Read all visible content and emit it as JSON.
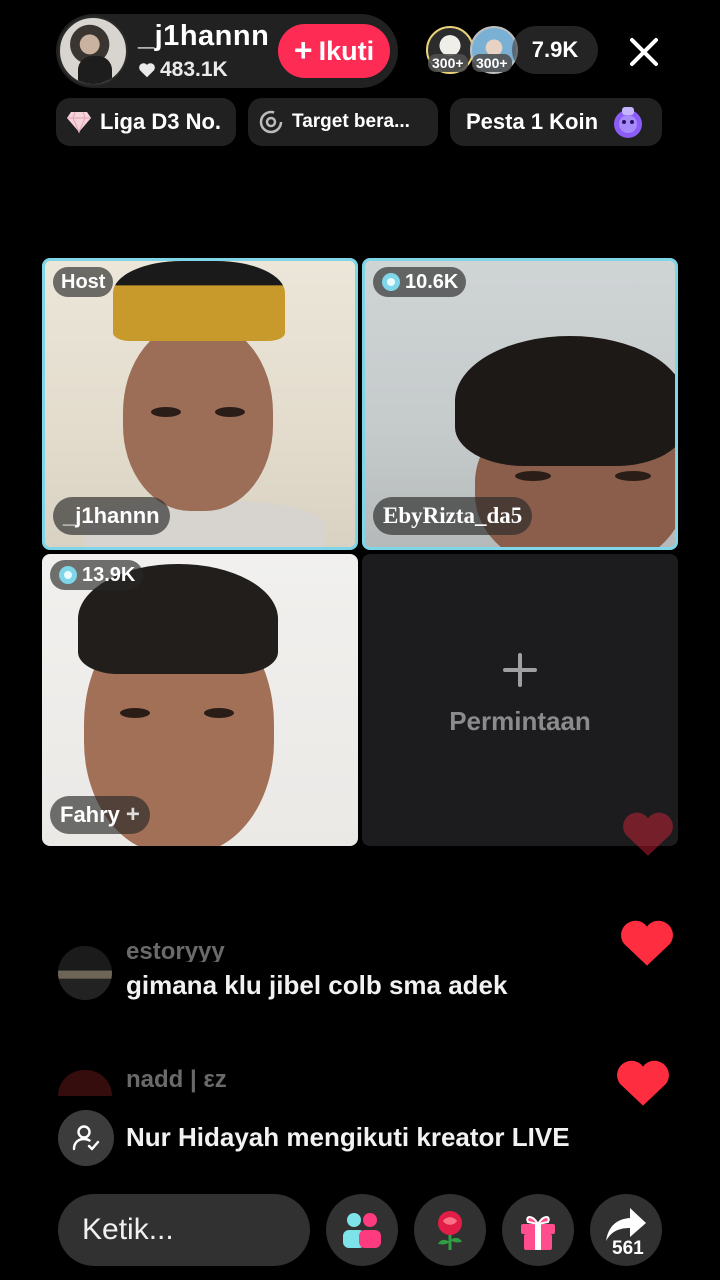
{
  "header": {
    "host_name": "_j1hannn",
    "host_likes": "483.1K",
    "follow_label": "Ikuti",
    "viewer_badges": [
      "300+",
      "300+"
    ],
    "viewer_count": "7.9K"
  },
  "chips": [
    {
      "label": "Liga D3 No.",
      "icon": "diamond-icon"
    },
    {
      "label": "Target bera...",
      "icon": "target-icon"
    },
    {
      "label": "Pesta 1 Koin",
      "icon": "treasure-bag-icon"
    }
  ],
  "grid": {
    "tiles": [
      {
        "badge": "Host",
        "name": "_j1hannn"
      },
      {
        "badge": "10.6K",
        "name": "EbyRizta_da5"
      },
      {
        "badge": "13.9K",
        "name": "Fahry"
      }
    ],
    "request_label": "Permintaan"
  },
  "comments": [
    {
      "user": "estoryyy",
      "text": "gimana klu jibel colb sma adek"
    },
    {
      "user": "nadd | εz",
      "text": ""
    }
  ],
  "notice": {
    "text": "Nur Hidayah mengikuti kreator LIVE"
  },
  "bottom": {
    "input_placeholder": "Ketik...",
    "share_count": "561"
  },
  "colors": {
    "accent": "#fe2c55",
    "tile_border": "#7fd6e8",
    "heart": "#ff2d40"
  }
}
